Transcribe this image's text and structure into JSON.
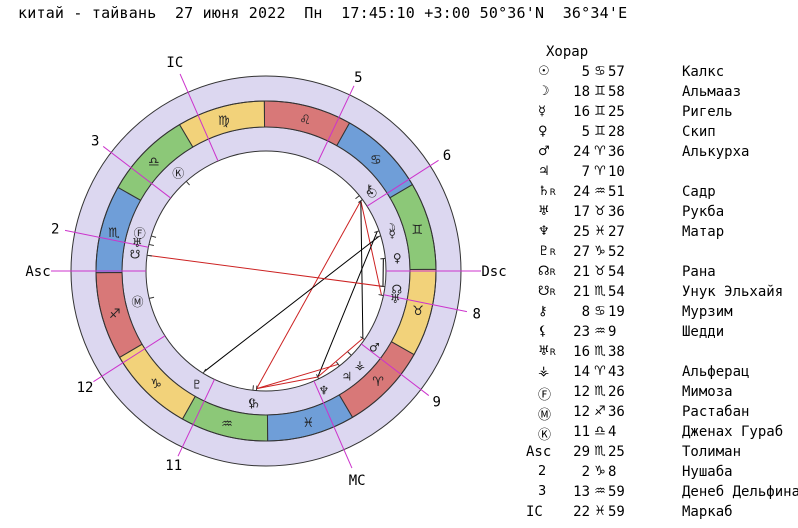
{
  "header": {
    "title": "китай - тайвань",
    "date": "27 июня 2022",
    "weekday": "Пн",
    "time": "17:45:10",
    "tz": "+3:00",
    "lat": "50°36'N",
    "lon": "36°34'E"
  },
  "table_title": "Хорар",
  "rows": [
    {
      "glyph": "☉",
      "retro": "",
      "deg": "5",
      "sign": "♋",
      "min": "57",
      "star": "Калкс"
    },
    {
      "glyph": "☽",
      "retro": "",
      "deg": "18",
      "sign": "♊",
      "min": "58",
      "star": "Альмааз"
    },
    {
      "glyph": "☿",
      "retro": "",
      "deg": "16",
      "sign": "♊",
      "min": "25",
      "star": "Ригель"
    },
    {
      "glyph": "♀",
      "retro": "",
      "deg": "5",
      "sign": "♊",
      "min": "28",
      "star": "Скип"
    },
    {
      "glyph": "♂",
      "retro": "",
      "deg": "24",
      "sign": "♈",
      "min": "36",
      "star": "Алькурха"
    },
    {
      "glyph": "♃",
      "retro": "",
      "deg": "7",
      "sign": "♈",
      "min": "10",
      "star": ""
    },
    {
      "glyph": "♄",
      "retro": "R",
      "deg": "24",
      "sign": "♒",
      "min": "51",
      "star": "Садр"
    },
    {
      "glyph": "♅",
      "retro": "",
      "deg": "17",
      "sign": "♉",
      "min": "36",
      "star": "Рукба"
    },
    {
      "glyph": "♆",
      "retro": "",
      "deg": "25",
      "sign": "♓",
      "min": "27",
      "star": "Матар"
    },
    {
      "glyph": "♇",
      "retro": "R",
      "deg": "27",
      "sign": "♑",
      "min": "52",
      "star": ""
    },
    {
      "glyph": "☊",
      "retro": "R",
      "deg": "21",
      "sign": "♉",
      "min": "54",
      "star": "Рана"
    },
    {
      "glyph": "☋",
      "retro": "R",
      "deg": "21",
      "sign": "♏",
      "min": "54",
      "star": "Унук Эльхайя"
    },
    {
      "glyph": "⚷",
      "retro": "",
      "deg": "8",
      "sign": "♋",
      "min": "19",
      "star": "Мурзим"
    },
    {
      "glyph": "⚸",
      "retro": "",
      "deg": "23",
      "sign": "♒",
      "min": "9",
      "star": "Шедди"
    },
    {
      "glyph": "♅",
      "retro": "R",
      "deg": "16",
      "sign": "♏",
      "min": "38",
      "star": ""
    },
    {
      "glyph": "⚶",
      "retro": "",
      "deg": "14",
      "sign": "♈",
      "min": "43",
      "star": "Альферац"
    },
    {
      "glyph": "Ⓕ",
      "retro": "",
      "deg": "12",
      "sign": "♏",
      "min": "26",
      "star": "Мимоза"
    },
    {
      "glyph": "Ⓜ",
      "retro": "",
      "deg": "12",
      "sign": "♐",
      "min": "36",
      "star": "Растабан"
    },
    {
      "glyph": "Ⓚ",
      "retro": "",
      "deg": "11",
      "sign": "♎",
      "min": "4",
      "star": "Дженах Гураб"
    },
    {
      "glyph": "Asc",
      "retro": "",
      "deg": "29",
      "sign": "♏",
      "min": "25",
      "star": "Толиман"
    },
    {
      "glyph": "2",
      "retro": "",
      "deg": "2",
      "sign": "♑",
      "min": "8",
      "star": "Нушаба"
    },
    {
      "glyph": "3",
      "retro": "",
      "deg": "13",
      "sign": "♒",
      "min": "59",
      "star": "Денеб Дельфина"
    },
    {
      "glyph": "IC",
      "retro": "",
      "deg": "22",
      "sign": "♓",
      "min": "59",
      "star": "Маркаб"
    }
  ],
  "wheel": {
    "house_labels": [
      "Asc",
      "12",
      "11",
      "MC",
      "9",
      "8",
      "Dsc",
      "6",
      "5",
      "IC",
      "3",
      "2"
    ],
    "signs": [
      "♈",
      "♉",
      "♊",
      "♋",
      "♌",
      "♍",
      "♎",
      "♏",
      "♐",
      "♑",
      "♒",
      "♓"
    ],
    "sign_colors": [
      "#d87878",
      "#f2d27a",
      "#8cc878",
      "#6f9ed8",
      "#d87878",
      "#f2d27a",
      "#8cc878",
      "#6f9ed8",
      "#d87878",
      "#f2d27a",
      "#8cc878",
      "#6f9ed8"
    ],
    "ring_color": "#dcd7f0",
    "axis_color": "#cc33cc",
    "planets": [
      {
        "glyph": "☉",
        "lon": 95.95
      },
      {
        "glyph": "☽",
        "lon": 78.97
      },
      {
        "glyph": "☿",
        "lon": 76.42
      },
      {
        "glyph": "♀",
        "lon": 65.47
      },
      {
        "glyph": "♂",
        "lon": 24.6
      },
      {
        "glyph": "♃",
        "lon": 7.17
      },
      {
        "glyph": "♄",
        "lon": 324.85
      },
      {
        "glyph": "♅",
        "lon": 47.6
      },
      {
        "glyph": "♆",
        "lon": 355.45
      },
      {
        "glyph": "♇",
        "lon": 297.87
      },
      {
        "glyph": "☊",
        "lon": 51.9
      },
      {
        "glyph": "☋",
        "lon": 231.9
      },
      {
        "glyph": "⚷",
        "lon": 98.32
      },
      {
        "glyph": "⚸",
        "lon": 323.15
      },
      {
        "glyph": "♅",
        "lon": 226.63
      },
      {
        "glyph": "⚶",
        "lon": 14.72
      },
      {
        "glyph": "Ⓕ",
        "lon": 222.43
      },
      {
        "glyph": "Ⓜ",
        "lon": 252.6
      },
      {
        "glyph": "Ⓚ",
        "lon": 191.07
      }
    ]
  }
}
